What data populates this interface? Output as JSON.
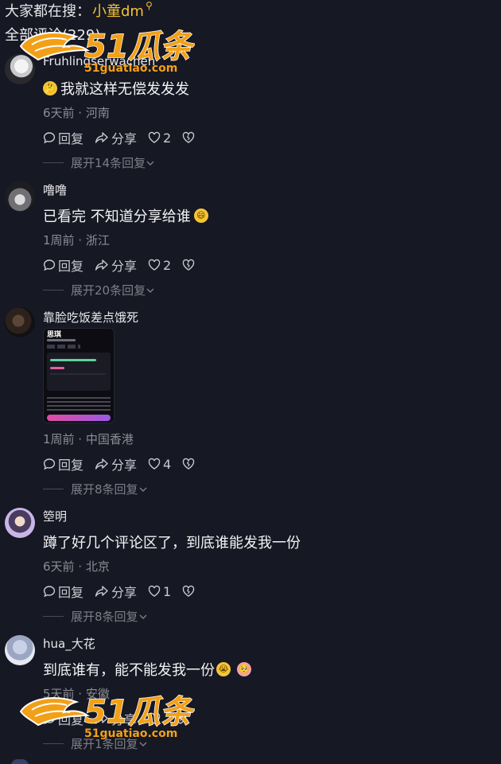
{
  "header": {
    "search_prefix": "大家都在搜：",
    "search_keyword": "小童dm",
    "comment_count": "全部评论(229)"
  },
  "labels": {
    "reply": "回复",
    "share": "分享"
  },
  "watermark": {
    "brand": "51瓜条",
    "domain": "51guatiao.com"
  },
  "comments": [
    {
      "username": "Fruhlingserwachen",
      "text": "我就这样无偿发发发",
      "emoji_before": "thinking-emoji",
      "meta": "6天前 · 河南",
      "likes": "2",
      "expand": "展开14条回复"
    },
    {
      "username": "噜噜",
      "text": "已看完 不知道分享给谁",
      "emoji_after": "grinning-emoji",
      "meta": "1周前 · 浙江",
      "likes": "2",
      "expand": "展开20条回复"
    },
    {
      "username": "靠脸吃饭差点饿死",
      "image_title": "思琪",
      "meta": "1周前 · 中国香港",
      "likes": "4",
      "expand": "展开8条回复"
    },
    {
      "username": "箜明",
      "text": "蹲了好几个评论区了，到底谁能发我一份",
      "meta": "6天前 · 北京",
      "likes": "1",
      "expand": "展开8条回复"
    },
    {
      "username": "hua_大花",
      "text": "到底谁有，能不能发我一份",
      "emoji_after": [
        "crying-emoji",
        "pleading-emoji"
      ],
      "meta": "5天前 · 安徽",
      "likes": "",
      "expand": "展开1条回复"
    }
  ]
}
